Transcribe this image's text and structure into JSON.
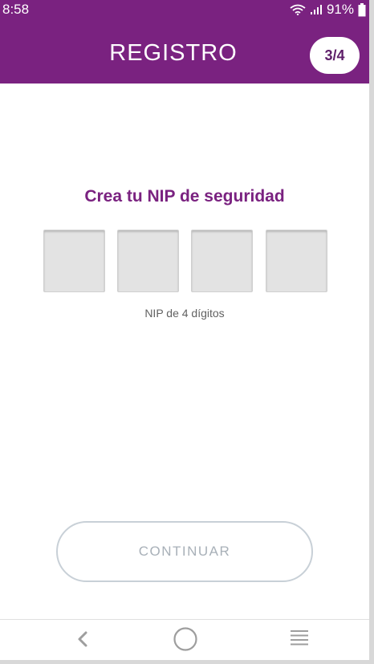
{
  "status_bar": {
    "time": "8:58",
    "battery_percent": "91%",
    "wifi_icon": "wifi-icon",
    "signal_icon": "signal-icon",
    "battery_icon": "battery-icon"
  },
  "header": {
    "title": "REGISTRO",
    "step": "3/4"
  },
  "pin": {
    "title": "Crea tu NIP de seguridad",
    "hint": "NIP de 4 dígitos",
    "digits": [
      "",
      "",
      "",
      ""
    ]
  },
  "actions": {
    "continue_label": "CONTINUAR"
  },
  "nav": {
    "back_icon": "back-chevron-icon",
    "home_icon": "home-circle-icon",
    "menu_icon": "menu-lines-icon"
  },
  "colors": {
    "brand": "#7a2280",
    "brand_text": "#7a2280",
    "pin_box": "#e3e3e3",
    "button_border": "#c8d0d7",
    "button_text": "#a8b0b8"
  }
}
